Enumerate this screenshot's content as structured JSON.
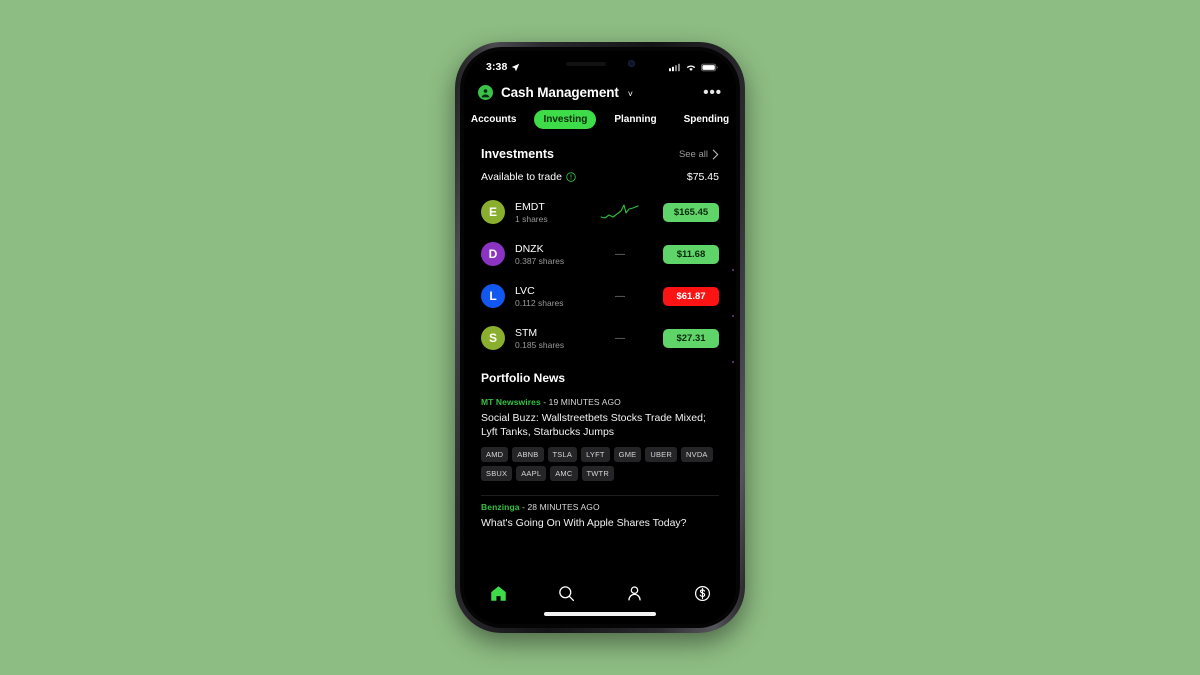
{
  "status_bar": {
    "time": "3:38",
    "location_icon": "location-arrow-icon",
    "cellular_icon": "cellular-signal-icon",
    "wifi_icon": "wifi-icon",
    "battery_icon": "battery-icon"
  },
  "header": {
    "avatar_icon": "person-avatar-icon",
    "title": "Cash Management",
    "chevron": "˅",
    "more_label": "•••"
  },
  "nav_tabs": [
    {
      "label": "Accounts",
      "active": false
    },
    {
      "label": "Investing",
      "active": true
    },
    {
      "label": "Planning",
      "active": false
    },
    {
      "label": "Spending",
      "active": false
    }
  ],
  "investments": {
    "section_title": "Investments",
    "see_all_label": "See all",
    "see_all_chevron": "›",
    "available_label": "Available to trade",
    "available_info_icon": "info-circle-icon",
    "available_amount": "$75.45",
    "holdings": [
      {
        "symbol": "EMDT",
        "initial": "E",
        "shares": "1 shares",
        "avatar_color": "#8aae2e",
        "trend": "sparkline",
        "dash": "—",
        "price": "$165.45",
        "direction": "up",
        "price_color": "#5fd468"
      },
      {
        "symbol": "DNZK",
        "initial": "D",
        "shares": "0.387 shares",
        "avatar_color": "#8b34c4",
        "trend": "dash",
        "dash": "—",
        "price": "$11.68",
        "direction": "up",
        "price_color": "#5fd468"
      },
      {
        "symbol": "LVC",
        "initial": "L",
        "shares": "0.112 shares",
        "avatar_color": "#1257ef",
        "trend": "dash",
        "dash": "—",
        "price": "$61.87",
        "direction": "down",
        "price_color": "#fc1414"
      },
      {
        "symbol": "STM",
        "initial": "S",
        "shares": "0.185 shares",
        "avatar_color": "#8aae2e",
        "trend": "dash",
        "dash": "—",
        "price": "$27.31",
        "direction": "up",
        "price_color": "#5fd468"
      }
    ]
  },
  "portfolio_news": {
    "section_title": "Portfolio News",
    "items": [
      {
        "source": "MT Newswires",
        "time": " - 19 MINUTES AGO",
        "headline": "Social Buzz: Wallstreetbets Stocks Trade Mixed; Lyft Tanks, Starbucks Jumps",
        "tags": [
          "AMD",
          "ABNB",
          "TSLA",
          "LYFT",
          "GME",
          "UBER",
          "NVDA",
          "SBUX",
          "AAPL",
          "AMC",
          "TWTR"
        ]
      },
      {
        "source": "Benzinga",
        "time": " - 28 MINUTES AGO",
        "headline": "What's Going On With Apple Shares Today?",
        "tags": []
      }
    ]
  },
  "bottom_nav": [
    {
      "icon": "home-icon",
      "active": true
    },
    {
      "icon": "search-icon",
      "active": false
    },
    {
      "icon": "person-icon",
      "active": false
    },
    {
      "icon": "dollar-circle-icon",
      "active": false
    }
  ],
  "colors": {
    "page_background": "#8ebd83",
    "app_background": "#000000",
    "accent_green": "#3ddc48",
    "source_green": "#35c244",
    "down_red": "#fc1414"
  }
}
